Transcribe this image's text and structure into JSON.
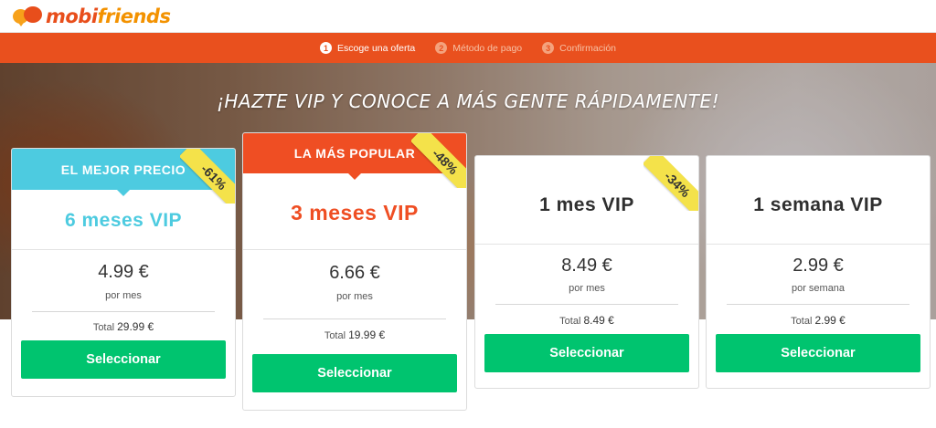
{
  "brand": {
    "name_part1": "mobi",
    "name_part2": "friends"
  },
  "steps": [
    {
      "num": "1",
      "label": "Escoge una oferta",
      "active": true
    },
    {
      "num": "2",
      "label": "Método de pago",
      "active": false
    },
    {
      "num": "3",
      "label": "Confirmación",
      "active": false
    }
  ],
  "hero": {
    "title": "¡HAZTE VIP Y CONOCE A MÁS GENTE RÁPIDAMENTE!"
  },
  "plans": [
    {
      "ribbon": "EL MEJOR PRECIO",
      "discount": "-61%",
      "title": "6 meses VIP",
      "price": "4.99 €",
      "period": "por mes",
      "total_label": "Total",
      "total_value": "29.99 €",
      "button": "Seleccionar",
      "title_color": "#4dcbe0",
      "ribbon_color": "#4dcbe0"
    },
    {
      "ribbon": "LA MÁS POPULAR",
      "discount": "-48%",
      "title": "3 meses VIP",
      "price": "6.66 €",
      "period": "por mes",
      "total_label": "Total",
      "total_value": "19.99 €",
      "button": "Seleccionar",
      "title_color": "#ef4e23",
      "ribbon_color": "#ef4e23"
    },
    {
      "ribbon": "",
      "discount": "-34%",
      "title": "1 mes VIP",
      "price": "8.49 €",
      "period": "por mes",
      "total_label": "Total",
      "total_value": "8.49 €",
      "button": "Seleccionar",
      "title_color": "#2f2f2f"
    },
    {
      "ribbon": "",
      "discount": "",
      "title": "1 semana VIP",
      "price": "2.99 €",
      "period": "por semana",
      "total_label": "Total",
      "total_value": "2.99 €",
      "button": "Seleccionar",
      "title_color": "#2f2f2f"
    }
  ],
  "colors": {
    "accent": "#e9501e",
    "button": "#00c46f",
    "discount_banner": "#f4e24a"
  }
}
